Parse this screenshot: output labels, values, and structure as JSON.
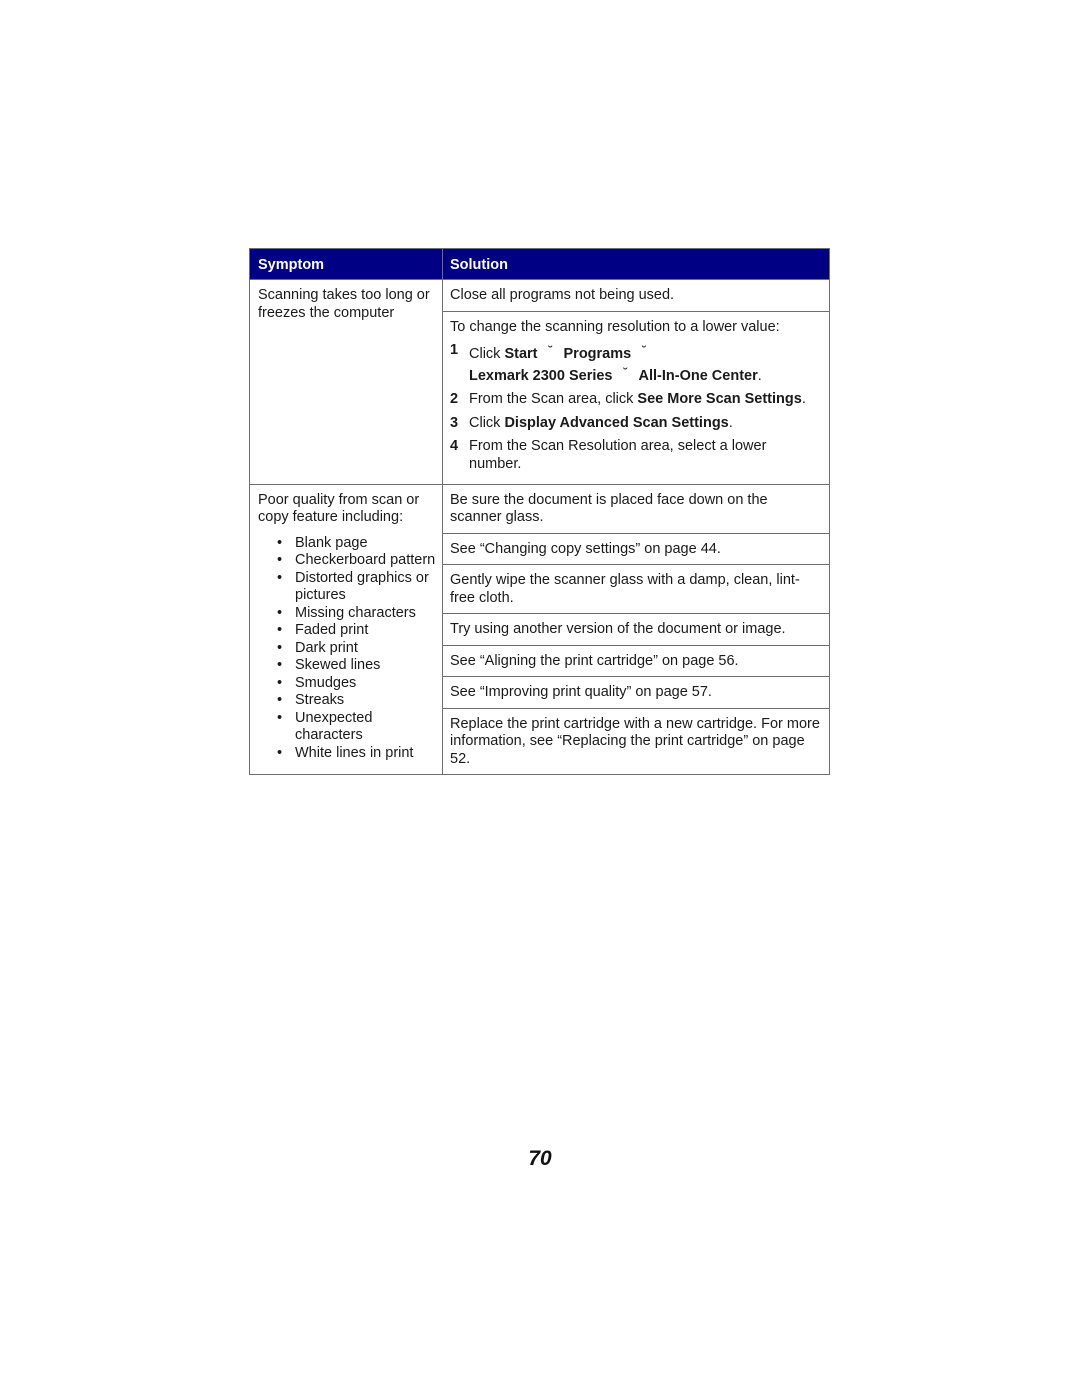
{
  "table": {
    "header": {
      "symptom": "Symptom",
      "solution": "Solution",
      "header_color": "#000085"
    },
    "rows": [
      {
        "symptom": "Scanning takes too long or freezes the computer",
        "solutions": [
          {
            "text": "Close all programs not being used."
          },
          {
            "intro": "To change the scanning resolution to a lower value:",
            "steps": [
              {
                "num": "1",
                "parts": [
                  {
                    "text": "Click ",
                    "bold": false
                  },
                  {
                    "text": "Start",
                    "bold": true
                  },
                  {
                    "text": "˘",
                    "arrow": true
                  },
                  {
                    "text": "Programs",
                    "bold": true
                  },
                  {
                    "text": "˘",
                    "arrow": true
                  },
                  {
                    "text": "Lexmark 2300 Series",
                    "bold": true,
                    "newline": true
                  },
                  {
                    "text": "˘",
                    "arrow": true
                  },
                  {
                    "text": "All-In-One Center",
                    "bold": true
                  },
                  {
                    "text": ".",
                    "bold": false
                  }
                ]
              },
              {
                "num": "2",
                "parts": [
                  {
                    "text": "From the Scan area, click ",
                    "bold": false
                  },
                  {
                    "text": "See More Scan Settings",
                    "bold": true
                  },
                  {
                    "text": ".",
                    "bold": false
                  }
                ]
              },
              {
                "num": "3",
                "parts": [
                  {
                    "text": "Click ",
                    "bold": false
                  },
                  {
                    "text": "Display Advanced Scan Settings",
                    "bold": true
                  },
                  {
                    "text": ".",
                    "bold": false
                  }
                ]
              },
              {
                "num": "4",
                "parts": [
                  {
                    "text": "From the Scan Resolution area, select a lower number.",
                    "bold": false
                  }
                ]
              }
            ]
          }
        ]
      },
      {
        "symptom": "Poor quality from scan or copy feature including:",
        "bullets": [
          "Blank page",
          "Checkerboard pattern",
          "Distorted graphics or pictures",
          "Missing characters",
          "Faded print",
          "Dark print",
          "Skewed lines",
          "Smudges",
          "Streaks",
          "Unexpected characters",
          "White lines in print"
        ],
        "solutions": [
          {
            "text": "Be sure the document is placed face down on the scanner glass."
          },
          {
            "text": "See “Changing copy settings” on page 44."
          },
          {
            "text": "Gently wipe the scanner glass with a damp, clean, lint-free cloth."
          },
          {
            "text": "Try using another version of the document or image."
          },
          {
            "text": "See “Aligning the print cartridge” on page 56."
          },
          {
            "text": "See “Improving print quality” on page 57."
          },
          {
            "text": "Replace the print cartridge with a new cartridge. For more information, see “Replacing the print cartridge” on page 52."
          }
        ]
      }
    ]
  },
  "page_number": "70"
}
